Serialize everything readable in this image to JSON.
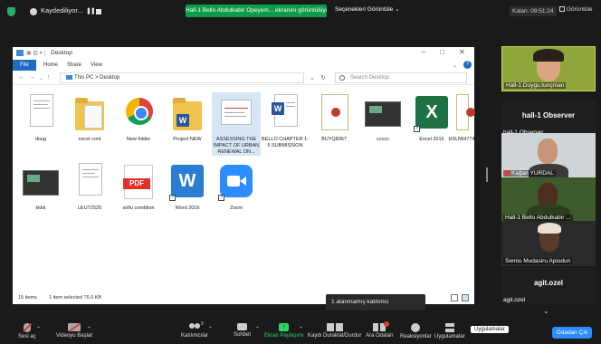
{
  "meeting": {
    "recording_label": "Kaydediliyor...",
    "share_banner": "Hall-1 Bello Abdulkabir Opeyem... ekranını görüntülüyorsunuz",
    "view_options": "Seçenekleri Görüntüle",
    "clock": "Kalan: 09:51:24",
    "gallery": "Görüntüle",
    "notice": "1 atanmamış katılımcı",
    "tooltip": "Uygulamalar"
  },
  "explorer": {
    "title": "Desktop",
    "ribbon_tabs": [
      "File",
      "Home",
      "Share",
      "View"
    ],
    "breadcrumb": "This PC  >  Desktop",
    "search_placeholder": "Search Desktop",
    "files": [
      {
        "label": "doug",
        "icon": "document"
      },
      {
        "label": "excel cont",
        "icon": "folder"
      },
      {
        "label": "New folder",
        "icon": "chrome"
      },
      {
        "label": "Project NEW",
        "icon": "word-folder"
      },
      {
        "label": "ASSESSING THE IMPACT OF URBAN RENEWAL ON...",
        "icon": "document-selected"
      },
      {
        "label": "BELLO CHAPTER 1-5 SUBMISSION",
        "icon": "word"
      },
      {
        "label": "BUYQ8067",
        "icon": "certificate"
      },
      {
        "label": "ccccc",
        "icon": "screenshot"
      },
      {
        "label": "Excel 2016",
        "icon": "excel"
      },
      {
        "label": "HSUW4774",
        "icon": "certificate"
      },
      {
        "label": "kkkk",
        "icon": "screenshot"
      },
      {
        "label": "LEUT2525",
        "icon": "document"
      },
      {
        "label": "sofiu condition",
        "icon": "pdf"
      },
      {
        "label": "Word 2016",
        "icon": "word-app"
      },
      {
        "label": "Zoom",
        "icon": "zoom"
      }
    ],
    "status_items": "15 items",
    "status_selected": "1 item selected  76.0 KB"
  },
  "participants": [
    {
      "name": "Hall-1.Duygu.tunçman",
      "video": true
    },
    {
      "name": "hall-1 Observer",
      "video": false,
      "title": "hall-1 Observer"
    },
    {
      "name": "Kağan YURDAL",
      "video": true
    },
    {
      "name": "Hall-1 Bello Abdulkabir ...",
      "video": true
    },
    {
      "name": "Semiu Mudasiru Apiodun",
      "video": true
    },
    {
      "name": "agit.ozel",
      "video": false,
      "title": "agit.ozel"
    }
  ],
  "toolbar": {
    "audio": "Sesi aç",
    "video": "Videoyu Başlat",
    "participants": "Katılımcılar",
    "participants_count": "9",
    "chat": "Sohbet",
    "share": "Ekran Paylaşımı",
    "record": "Kaydı Duraklat/Durdur",
    "breakout": "Ara Odaları",
    "reactions": "Reaksiyonlar",
    "apps": "Uygulamalar",
    "end": "Odadan Çık"
  },
  "colors": {
    "zoom_blue": "#2d8cff",
    "share_green": "#0e9d47",
    "mute_red": "#e03c31"
  }
}
